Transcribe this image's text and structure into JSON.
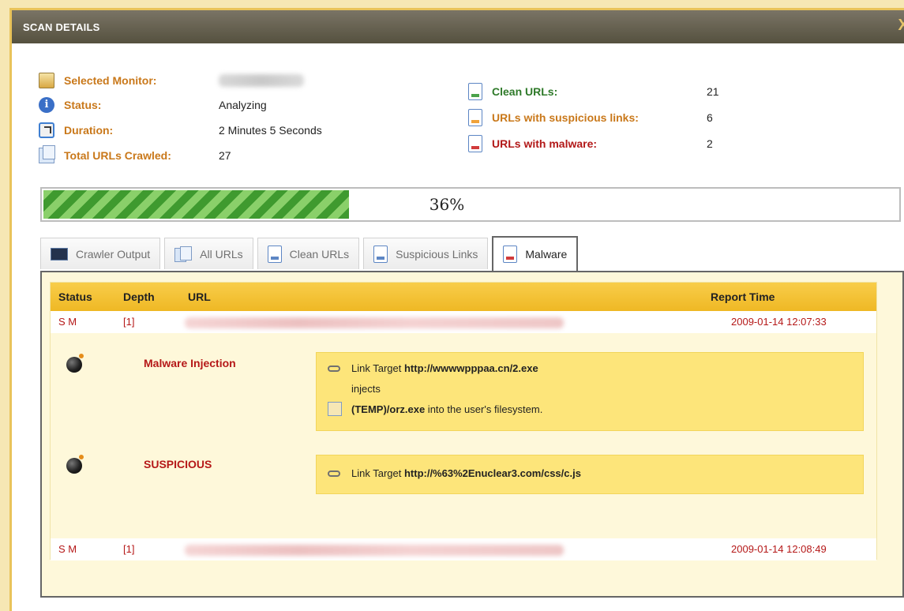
{
  "window": {
    "title": "SCAN DETAILS",
    "close_glyph": "X"
  },
  "info": {
    "selected_monitor_label": "Selected Monitor:",
    "status_label": "Status:",
    "status_value": "Analyzing",
    "duration_label": "Duration:",
    "duration_value": "2 Minutes 5 Seconds",
    "total_urls_label": "Total URLs Crawled:",
    "total_urls_value": "27",
    "clean_urls_label": "Clean URLs:",
    "clean_urls_value": "21",
    "suspicious_label": "URLs with suspicious links:",
    "suspicious_value": "6",
    "malware_label": "URLs with malware:",
    "malware_value": "2",
    "icons": [
      "monitor-icon",
      "info-icon",
      "clock-icon",
      "pages-icon",
      "document-icon"
    ]
  },
  "progress": {
    "value": 0.36,
    "label": "36%"
  },
  "tabs": [
    {
      "label": "Crawler Output",
      "icon": "terminal-icon"
    },
    {
      "label": "All URLs",
      "icon": "pages-icon"
    },
    {
      "label": "Clean URLs",
      "icon": "document-icon"
    },
    {
      "label": "Suspicious Links",
      "icon": "document-icon"
    },
    {
      "label": "Malware",
      "icon": "document-icon",
      "active": true
    }
  ],
  "grid": {
    "columns": [
      "Status",
      "Depth",
      "URL",
      "Report Time"
    ],
    "rows": [
      {
        "status": "S M",
        "depth": "[1]",
        "report_time": "2009-01-14 12:07:33",
        "details": [
          {
            "threat": "Malware Injection",
            "link_prefix": "Link Target ",
            "link_url": "http://wwwwpppaa.cn/2.exe",
            "injects_text": "injects",
            "file_path": "(TEMP)/orz.exe",
            "file_suffix": " into the user's filesystem."
          },
          {
            "threat": "SUSPICIOUS",
            "link_prefix": "Link Target ",
            "link_url": "http://%63%2Enuclear3.com/css/c.js"
          }
        ]
      },
      {
        "status": "S M",
        "depth": "[1]",
        "report_time": "2009-01-14 12:08:49"
      }
    ]
  },
  "colors": {
    "title_bar": "#625d4d",
    "accent_gold": "#efb824",
    "detail_yellow": "#fde57a",
    "status_red": "#b51818",
    "label_orange": "#c9781a",
    "label_green": "#2f7a2a",
    "progress_green": "#3f9a2f"
  }
}
